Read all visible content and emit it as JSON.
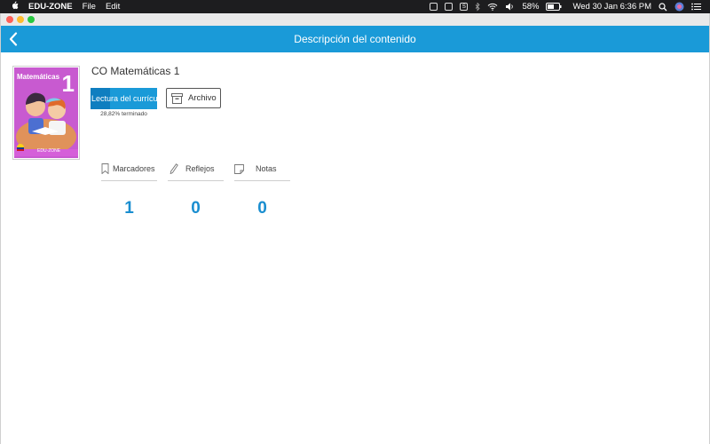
{
  "menubar": {
    "app_name": "EDU-ZONE",
    "menu_file": "File",
    "menu_edit": "Edit",
    "battery": "58%",
    "clock": "Wed 30 Jan  6:36 PM"
  },
  "header": {
    "title": "Descripción del contenido"
  },
  "book": {
    "title": "CO Matemáticas 1",
    "cover_title": "Matemáticas",
    "cover_number": "1",
    "cover_brand": "EDU·ZONE",
    "read_button_label": "Lectura del currículo",
    "progress_text": "28,82% terminado",
    "progress_fraction": 0.2882,
    "archive_button_label": "Archivo"
  },
  "stats": [
    {
      "label": "Marcadores",
      "value": "1",
      "icon": "bookmark-icon"
    },
    {
      "label": "Reflejos",
      "value": "0",
      "icon": "pencil-icon"
    },
    {
      "label": "Notas",
      "value": "0",
      "icon": "note-icon"
    }
  ],
  "colors": {
    "accent": "#1a9ad8",
    "stat_value": "#1a8ed0"
  }
}
